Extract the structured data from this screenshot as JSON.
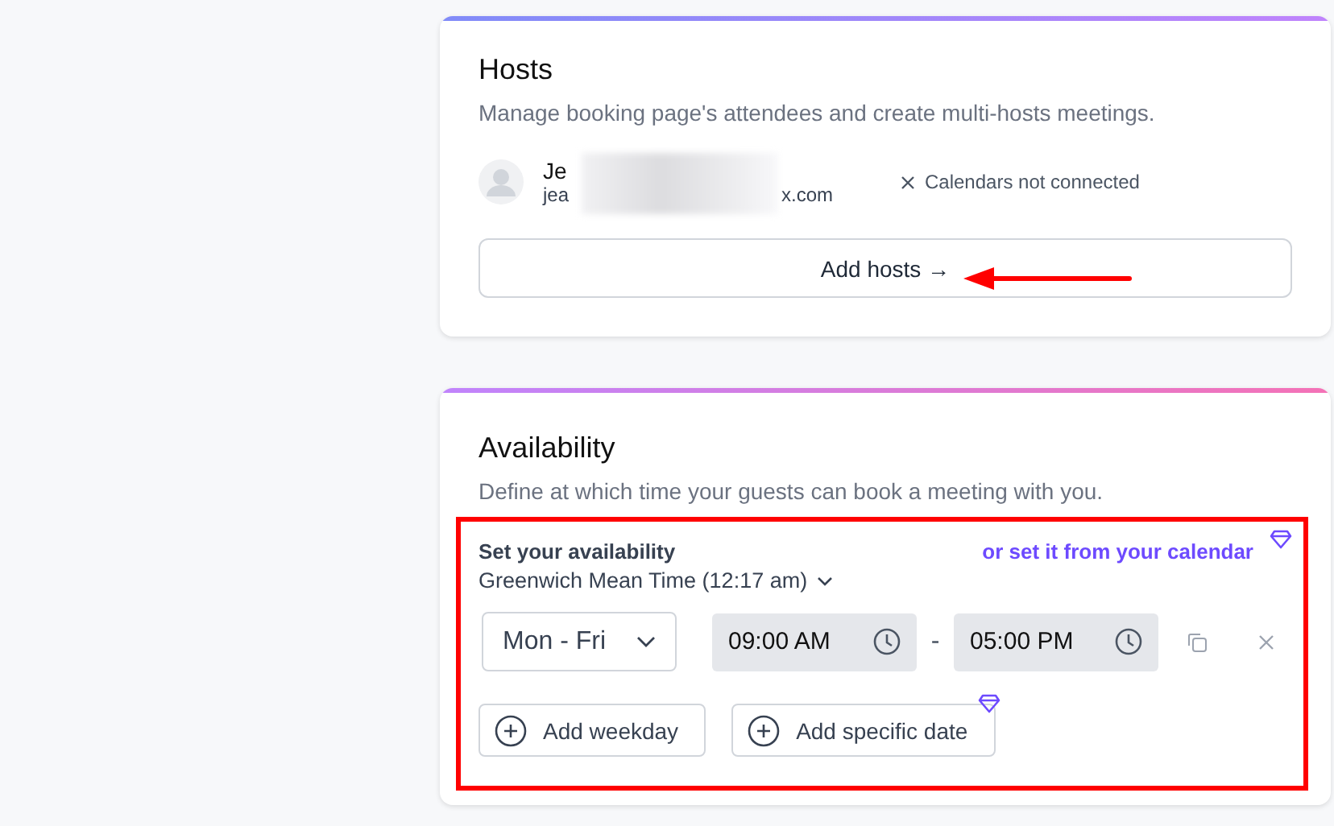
{
  "hosts_card": {
    "title": "Hosts",
    "description": "Manage booking page's attendees and create multi-hosts meetings.",
    "host": {
      "name": "Je",
      "email_start": "jea",
      "email_end": "x.com",
      "redacted": true,
      "calendar_status": "Calendars not connected"
    },
    "add_button": "Add hosts →"
  },
  "availability_card": {
    "title": "Availability",
    "description": "Define at which time your guests can book a meeting with you.",
    "heading": "Set your availability",
    "calendar_link": "or set it from your calendar",
    "timezone": "Greenwich Mean Time (12:17 am)",
    "day_range": "Mon - Fri",
    "start_time": "09:00 AM",
    "separator": "-",
    "end_time": "05:00 PM",
    "buttons": [
      {
        "label": "Add weekday",
        "premium": false
      },
      {
        "label": "Add specific date",
        "premium": true
      }
    ]
  }
}
